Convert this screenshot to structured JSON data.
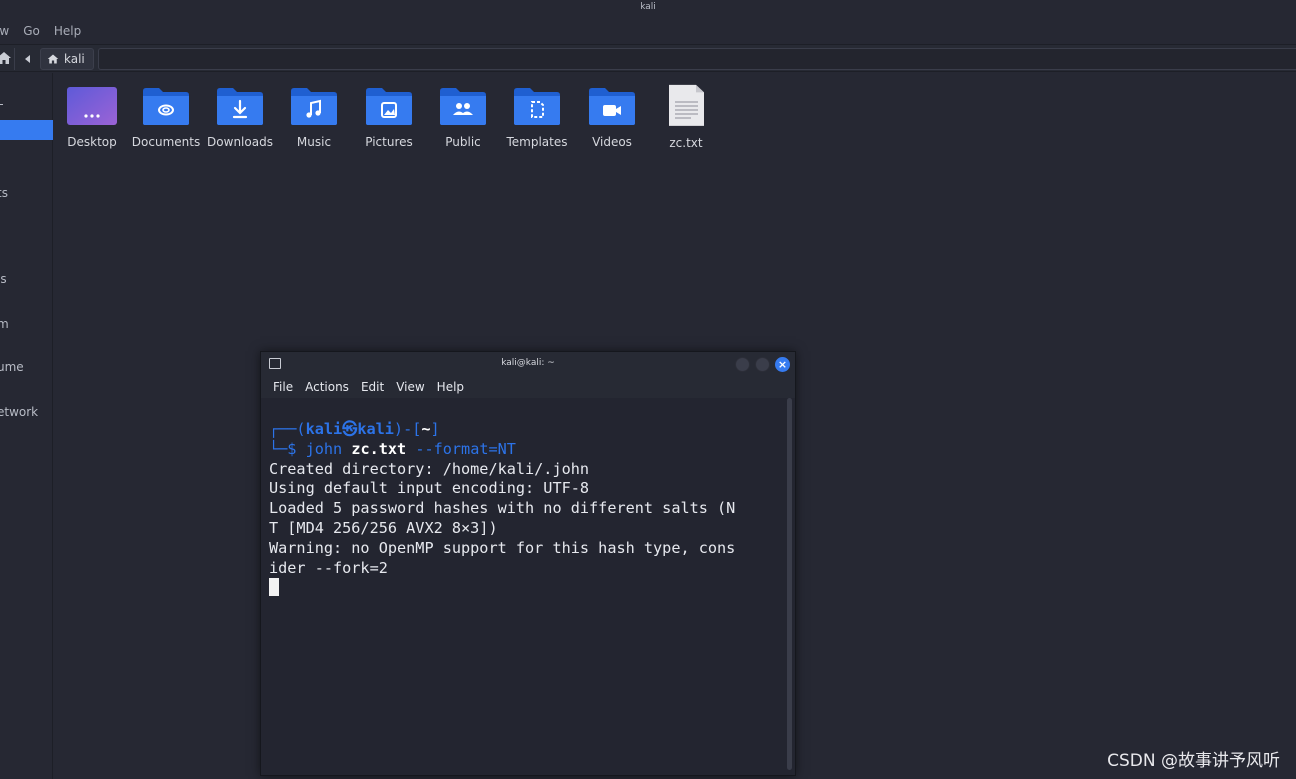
{
  "file_manager": {
    "window_title": "kali",
    "menu": [
      "ew",
      "Go",
      "Help"
    ],
    "breadcrumb": "kali",
    "sidebar": [
      {
        "label": "",
        "selected": false
      },
      {
        "label": "",
        "selected": true
      },
      {
        "label": "ts",
        "selected": false
      },
      {
        "label": "ls",
        "selected": false
      },
      {
        "label": "m",
        "selected": false
      },
      {
        "label": "ume",
        "selected": false
      },
      {
        "label": "etwork",
        "selected": false
      }
    ],
    "items": [
      {
        "label": "Desktop",
        "icon": "desktop-folder-icon"
      },
      {
        "label": "Documents",
        "icon": "documents-folder-icon"
      },
      {
        "label": "Downloads",
        "icon": "downloads-folder-icon"
      },
      {
        "label": "Music",
        "icon": "music-folder-icon"
      },
      {
        "label": "Pictures",
        "icon": "pictures-folder-icon"
      },
      {
        "label": "Public",
        "icon": "public-folder-icon"
      },
      {
        "label": "Templates",
        "icon": "templates-folder-icon"
      },
      {
        "label": "Videos",
        "icon": "videos-folder-icon"
      },
      {
        "label": "zc.txt",
        "icon": "text-file-icon"
      }
    ]
  },
  "terminal": {
    "title": "kali@kali: ~",
    "menu": [
      "File",
      "Actions",
      "Edit",
      "View",
      "Help"
    ],
    "prompt": {
      "frame_open": "┌──(",
      "user": "kali",
      "at": "㉿",
      "host": "kali",
      "mid": ")-[",
      "dir": "~",
      "close": "]",
      "frame_cmd": "└─$ "
    },
    "command": {
      "program": "john",
      "argument": "zc.txt",
      "option": "--format=NT"
    },
    "output": [
      "Created directory: /home/kali/.john",
      "Using default input encoding: UTF-8",
      "Loaded 5 password hashes with no different salts (N",
      "T [MD4 256/256 AVX2 8×3])",
      "Warning: no OpenMP support for this hash type, cons",
      "ider --fork=2"
    ]
  },
  "watermark": "CSDN @故事讲予风听",
  "colors": {
    "accent": "#367bf0",
    "background": "#262833",
    "terminal_bg": "#232530"
  }
}
